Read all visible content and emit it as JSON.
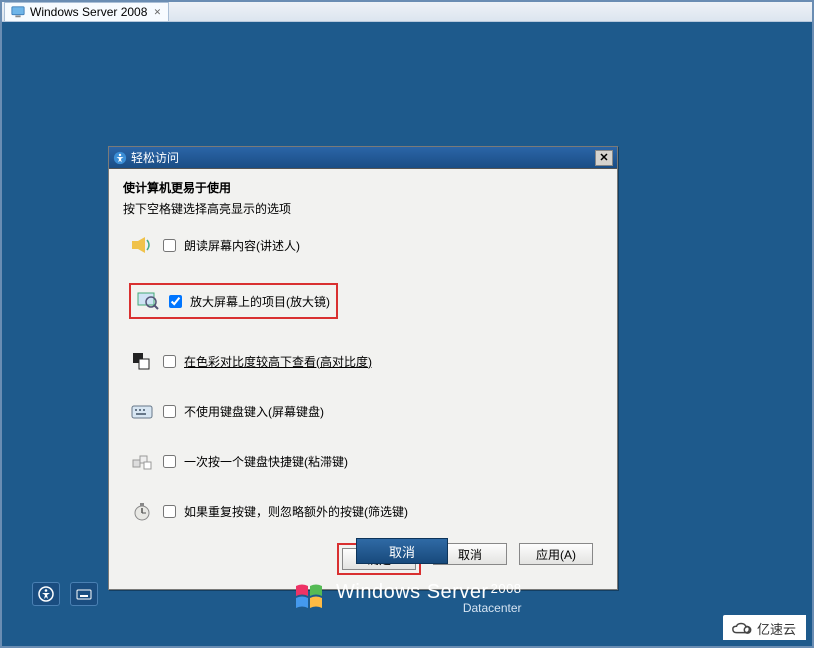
{
  "tab": {
    "title": "Windows Server 2008"
  },
  "dialog": {
    "title": "轻松访问",
    "heading": "使计算机更易于使用",
    "subtext": "按下空格键选择高亮显示的选项",
    "options": [
      {
        "label": "朗读屏幕内容(讲述人)",
        "checked": false
      },
      {
        "label": "放大屏幕上的项目(放大镜)",
        "checked": true,
        "highlighted": true
      },
      {
        "label": "在色彩对比度较高下查看(高对比度)",
        "checked": false,
        "underline": true
      },
      {
        "label": "不使用键盘键入(屏幕键盘)",
        "checked": false
      },
      {
        "label": "一次按一个键盘快捷键(粘滞键)",
        "checked": false
      },
      {
        "label": "如果重复按键，则忽略额外的按键(筛选键)",
        "checked": false
      }
    ],
    "buttons": {
      "ok": "确定",
      "cancel": "取消",
      "apply": "应用(A)"
    }
  },
  "desktop": {
    "cancel_btn": "取消",
    "logo_line1": "Windows Server",
    "logo_year": "2008",
    "logo_line2": "Datacenter"
  },
  "watermark": {
    "text": "亿速云"
  }
}
